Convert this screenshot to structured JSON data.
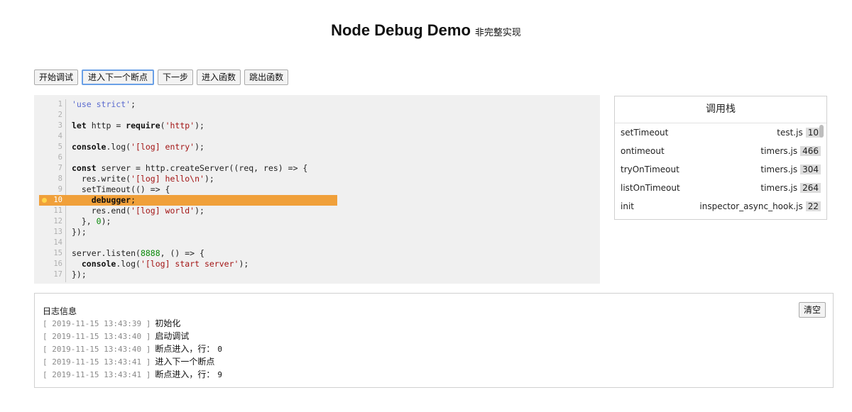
{
  "title": {
    "main": "Node Debug Demo",
    "sub": "非完整实现"
  },
  "toolbar": {
    "start": "开始调试",
    "next_breakpoint": "进入下一个断点",
    "step_over": "下一步",
    "step_into": "进入函数",
    "step_out": "跳出函数"
  },
  "code": {
    "current_line": 10,
    "lines": [
      "'use strict';",
      "",
      "let http = require('http');",
      "",
      "console.log('[log] entry');",
      "",
      "const server = http.createServer((req, res) => {",
      "  res.write('[log] hello\\n');",
      "  setTimeout(() => {",
      "    debugger;",
      "    res.end('[log] world');",
      "  }, 0);",
      "});",
      "",
      "server.listen(8888, () => {",
      "  console.log('[log] start server');",
      "});"
    ]
  },
  "callstack": {
    "title": "调用栈",
    "frames": [
      {
        "fn": "setTimeout",
        "file": "test.js",
        "line": "10"
      },
      {
        "fn": "ontimeout",
        "file": "timers.js",
        "line": "466"
      },
      {
        "fn": "tryOnTimeout",
        "file": "timers.js",
        "line": "304"
      },
      {
        "fn": "listOnTimeout",
        "file": "timers.js",
        "line": "264"
      },
      {
        "fn": "init",
        "file": "inspector_async_hook.js",
        "line": "22"
      }
    ]
  },
  "log": {
    "title": "日志信息",
    "clear_label": "清空",
    "entries": [
      {
        "ts": "[ 2019-11-15 13:43:39 ]",
        "msg": "初始化",
        "extra": ""
      },
      {
        "ts": "[ 2019-11-15 13:43:40 ]",
        "msg": "启动调试",
        "extra": ""
      },
      {
        "ts": "[ 2019-11-15 13:43:40 ]",
        "msg": "断点进入，行：",
        "extra": "0"
      },
      {
        "ts": "[ 2019-11-15 13:43:41 ]",
        "msg": "进入下一个断点",
        "extra": ""
      },
      {
        "ts": "[ 2019-11-15 13:43:41 ]",
        "msg": "断点进入，行：",
        "extra": "9"
      }
    ]
  }
}
